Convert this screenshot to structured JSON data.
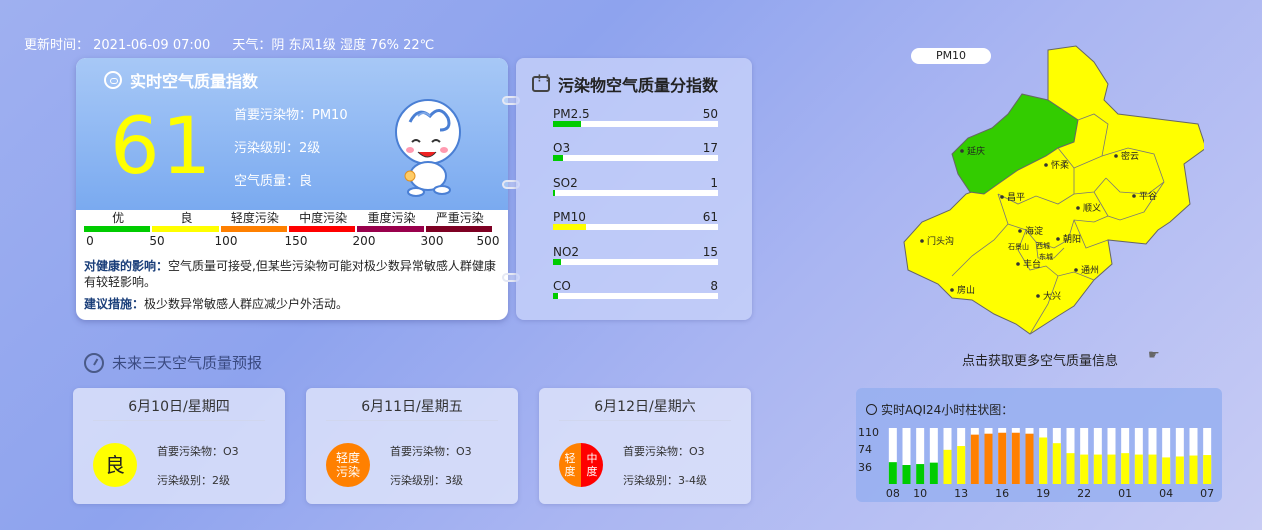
{
  "header": {
    "update_time": "更新时间： 2021-06-09 07:00",
    "weather": "天气：阴 东风1级 湿度 76% 22℃"
  },
  "aqi": {
    "title": "实时空气质量指数",
    "value": "61",
    "primary_pollutant": "首要污染物：PM10",
    "level": "污染级别：2级",
    "quality": "空气质量：良",
    "scale_labels": [
      "优",
      "良",
      "轻度污染",
      "中度污染",
      "重度污染",
      "严重污染"
    ],
    "scale_colors": [
      "#00cc00",
      "#ffff00",
      "#ff8000",
      "#ff0000",
      "#99004c",
      "#7e0023"
    ],
    "scale_numbers": [
      "0",
      "50",
      "100",
      "150",
      "200",
      "300",
      "500"
    ],
    "health_label": "对健康的影响：",
    "health_text": "空气质量可接受,但某些污染物可能对极少数异常敏感人群健康有较轻影响。",
    "advice_label": "建议措施：",
    "advice_text": "极少数异常敏感人群应减少户外活动。"
  },
  "pollutants": {
    "title": "污染物空气质量分指数",
    "items": [
      {
        "name": "PM2.5",
        "value": "50",
        "fraction": 0.17,
        "color": "#00cc00"
      },
      {
        "name": "O3",
        "value": "17",
        "fraction": 0.06,
        "color": "#00cc00"
      },
      {
        "name": "SO2",
        "value": "1",
        "fraction": 0.01,
        "color": "#00cc00"
      },
      {
        "name": "PM10",
        "value": "61",
        "fraction": 0.2,
        "color": "#ffff00"
      },
      {
        "name": "NO2",
        "value": "15",
        "fraction": 0.05,
        "color": "#00cc00"
      },
      {
        "name": "CO",
        "value": "8",
        "fraction": 0.03,
        "color": "#00cc00"
      }
    ]
  },
  "map": {
    "label": "PM10",
    "more_link": "点击获取更多空气质量信息",
    "districts": [
      "延庆",
      "怀柔",
      "密云",
      "昌平",
      "顺义",
      "平谷",
      "门头沟",
      "海淀",
      "朝阳",
      "石景山",
      "西城",
      "东城",
      "丰台",
      "通州",
      "房山",
      "大兴"
    ],
    "colors": {
      "good_green": "#33cc00",
      "moderate_yellow": "#ffff00"
    }
  },
  "forecast": {
    "title": "未来三天空气质量预报",
    "days": [
      {
        "date": "6月10日/星期四",
        "badge": "良",
        "pollutant": "首要污染物：O3",
        "level": "污染级别：2级"
      },
      {
        "date": "6月11日/星期五",
        "badge": "轻度污染",
        "pollutant": "首要污染物：O3",
        "level": "污染级别：3级"
      },
      {
        "date": "6月12日/星期六",
        "badge_left": "轻度",
        "badge_right": "中度",
        "pollutant": "首要污染物：O3",
        "level": "污染级别：3-4级"
      }
    ]
  },
  "chart_data": {
    "type": "bar",
    "title": "实时AQI24小时柱状图：",
    "yticks": [
      36,
      74,
      110
    ],
    "ylim": [
      0,
      118
    ],
    "xtick_labels": [
      "08",
      "10",
      "13",
      "16",
      "19",
      "22",
      "01",
      "04",
      "07"
    ],
    "hours": [
      "08",
      "09",
      "10",
      "11",
      "12",
      "13",
      "14",
      "15",
      "16",
      "17",
      "18",
      "19",
      "20",
      "21",
      "22",
      "23",
      "00",
      "01",
      "02",
      "03",
      "04",
      "05",
      "06",
      "07"
    ],
    "values": [
      46,
      40,
      42,
      45,
      72,
      80,
      104,
      106,
      108,
      108,
      106,
      98,
      86,
      65,
      62,
      62,
      62,
      65,
      62,
      62,
      56,
      58,
      60,
      61
    ],
    "colors": [
      "#00cc00",
      "#00cc00",
      "#00cc00",
      "#00cc00",
      "#ffff00",
      "#ffff00",
      "#ff8000",
      "#ff8000",
      "#ff8000",
      "#ff8000",
      "#ff8000",
      "#ffff00",
      "#ffff00",
      "#ffff00",
      "#ffff00",
      "#ffff00",
      "#ffff00",
      "#ffff00",
      "#ffff00",
      "#ffff00",
      "#ffff00",
      "#ffff00",
      "#ffff00",
      "#ffff00"
    ]
  }
}
